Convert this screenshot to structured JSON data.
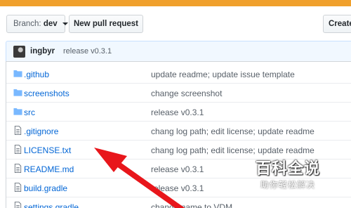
{
  "colors": {
    "language_bar": "#f0a02c",
    "link": "#0366d6",
    "muted": "#586069",
    "commit_bar_bg": "#f1f8ff",
    "arrow": "#e8161b"
  },
  "toolbar": {
    "branch_prefix": "Branch:",
    "branch_name": "dev",
    "new_pull_request": "New pull request",
    "create_label": "Create"
  },
  "latest_commit": {
    "author": "ingbyr",
    "message": "release v0.3.1"
  },
  "files": [
    {
      "name": ".github",
      "type": "folder",
      "icon": "folder-icon",
      "message": "update readme; update issue template"
    },
    {
      "name": "screenshots",
      "type": "folder",
      "icon": "folder-icon",
      "message": "change screenshot"
    },
    {
      "name": "src",
      "type": "folder",
      "icon": "folder-icon",
      "message": "release v0.3.1"
    },
    {
      "name": ".gitignore",
      "type": "file",
      "icon": "file-icon",
      "message": "chang log path; edit license; update readme"
    },
    {
      "name": "LICENSE.txt",
      "type": "file",
      "icon": "file-icon",
      "message": "chang log path; edit license; update readme"
    },
    {
      "name": "README.md",
      "type": "file",
      "icon": "file-icon",
      "message": "release v0.3.1"
    },
    {
      "name": "build.gradle",
      "type": "file",
      "icon": "file-icon",
      "message": "release v0.3.1"
    },
    {
      "name": "settings.gradle",
      "type": "file",
      "icon": "file-icon",
      "message": "change name to VDM"
    }
  ],
  "watermark": {
    "main": "百科全说",
    "sub": "助你轻松解决"
  }
}
